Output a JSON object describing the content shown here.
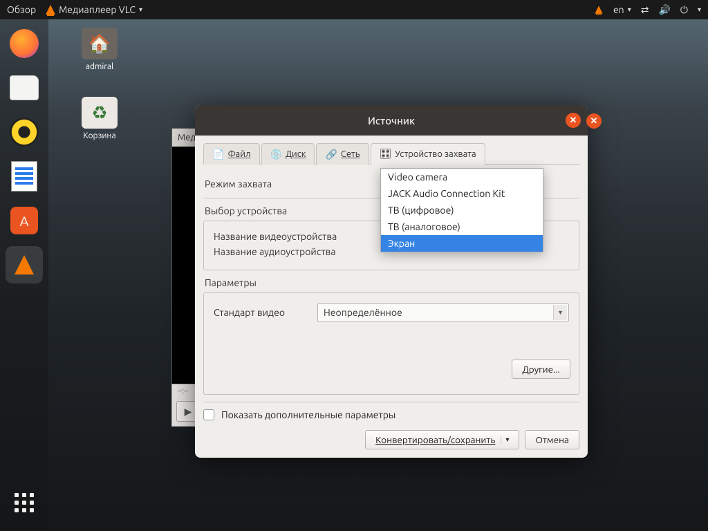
{
  "top_panel": {
    "overview": "Обзор",
    "app_menu": "Медиаплеер VLC",
    "lang": "en"
  },
  "desktop": {
    "home_folder": "admiral",
    "trash": "Корзина"
  },
  "vlc_bg": {
    "menu_fragment": "Мед",
    "time_l": "--:--",
    "time_r": "--:--"
  },
  "dialog": {
    "title": "Источник",
    "tabs": {
      "file": "Файл",
      "disc": "Диск",
      "network": "Сеть",
      "capture": "Устройство захвата"
    },
    "capture_mode_label": "Режим захвата",
    "capture_options": [
      "Video camera",
      "JACK Audio Connection Kit",
      "ТВ (цифровое)",
      "ТВ (аналоговое)",
      "Экран"
    ],
    "capture_selected_index": 4,
    "device_section": "Выбор устройства",
    "video_device_label": "Название видеоустройства",
    "audio_device_label": "Название аудиоустройства",
    "params_section": "Параметры",
    "video_standard_label": "Стандарт видео",
    "video_standard_value": "Неопределённое",
    "more_button": "Другие...",
    "show_more_params": "Показать дополнительные параметры",
    "convert_button": "Конвертировать/сохранить",
    "cancel_button": "Отмена"
  }
}
